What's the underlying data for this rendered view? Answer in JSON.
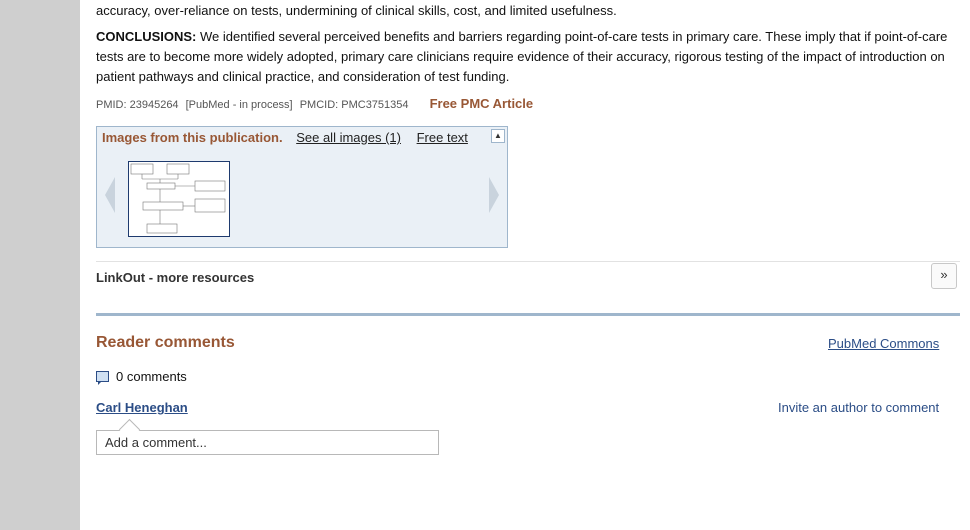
{
  "abstract": {
    "results_tail": "accuracy, over-reliance on tests, undermining of clinical skills, cost, and limited usefulness.",
    "conclusions_label": "CONCLUSIONS:",
    "conclusions_text": " We identified several perceived benefits and barriers regarding point-of-care tests in primary care. These imply that if point-of-care tests are to become more widely adopted, primary care clinicians require evidence of their accuracy, rigorous testing of the impact of introduction on patient pathways and clinical practice, and consideration of test funding."
  },
  "identifiers": {
    "pmid": "PMID: 23945264",
    "pubmed_status": "[PubMed - in process]",
    "pmcid": "PMCID: PMC3751354",
    "free_pmc": "Free PMC Article"
  },
  "images_panel": {
    "title": "Images from this publication.",
    "see_all": "See all images (1)",
    "free_text": "Free text"
  },
  "linkout": {
    "label": "LinkOut - more resources"
  },
  "comments": {
    "title": "Reader comments",
    "pubmed_commons": "PubMed Commons",
    "count_text": "0 comments",
    "author": "Carl Heneghan",
    "invite": "Invite an author to comment",
    "input_placeholder": "Add a comment..."
  },
  "colors": {
    "heading_brown": "#985735",
    "link_blue": "#2b4d86",
    "panel_border": "#9fb6cc"
  }
}
